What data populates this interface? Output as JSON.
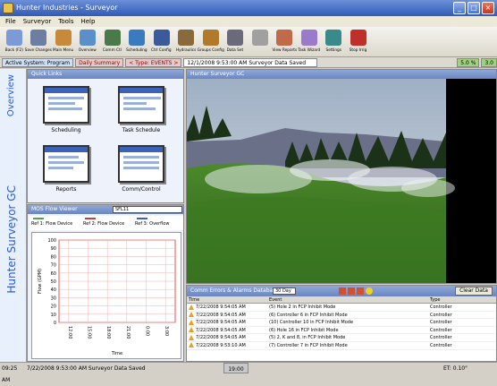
{
  "window": {
    "title": "Hunter Industries - Surveyor"
  },
  "menu": [
    "File",
    "Surveyor",
    "Tools",
    "Help"
  ],
  "toolbar": [
    {
      "label": "Back (F2)",
      "icon": "back-arrow-icon",
      "color": "#7a9ad8"
    },
    {
      "label": "Save Changes",
      "icon": "save-icon",
      "color": "#6d7fa0"
    },
    {
      "label": "Main Menu",
      "icon": "home-icon",
      "color": "#c88a3a"
    },
    {
      "label": "Overview",
      "icon": "map-icon",
      "color": "#5b8fc9"
    },
    {
      "label": "Comm Ctl",
      "icon": "antenna-icon",
      "color": "#4a7a4a"
    },
    {
      "label": "Scheduling",
      "icon": "magnifier-icon",
      "color": "#3a7bbf"
    },
    {
      "label": "Ctrl Config",
      "icon": "monitor-icon",
      "color": "#3a5a9a"
    },
    {
      "label": "Hydraulics",
      "icon": "valve-icon",
      "color": "#8a6a3a"
    },
    {
      "label": "Groups Config",
      "icon": "building-icon",
      "color": "#b07a2a"
    },
    {
      "label": "Data Set",
      "icon": "faucet-icon",
      "color": "#6a6a7a"
    },
    {
      "label": "",
      "icon": "wand-icon",
      "color": "#a0a0a0"
    },
    {
      "label": "View Reports",
      "icon": "report-icon",
      "color": "#c06a4a"
    },
    {
      "label": "Task Wizard",
      "icon": "wizard-icon",
      "color": "#9a7acb"
    },
    {
      "label": "Settings",
      "icon": "gear-icon",
      "color": "#3a8a8a"
    },
    {
      "label": "Stop Irrig",
      "icon": "stop-icon",
      "color": "#c0302a"
    }
  ],
  "statusline": {
    "system": "Active System: Program",
    "summary": "Daily Summary",
    "type": "< Type: EVENTS >",
    "event": "12/1/2008 9:53:00 AM Surveyor Data Saved",
    "left_val": "5.0 %",
    "right_val": "3.0"
  },
  "sidebar": {
    "overview": "Overview",
    "brand": "Hunter Surveyor GC"
  },
  "quick_links": {
    "title": "Quick Links",
    "items": [
      "Scheduling",
      "Task Schedule",
      "Reports",
      "Comm/Control"
    ]
  },
  "viewer": {
    "title": "MOS Flow Viewer",
    "select": "SFL11",
    "legend": [
      "Ref 1: Flow Device",
      "Ref 2: Flow Device",
      "Ref 3: Overflow"
    ],
    "legend_colors": [
      "#5aa04a",
      "#c04040",
      "#3a60c0"
    ]
  },
  "camera": {
    "title": "Hunter Surveyor GC"
  },
  "alarms": {
    "title": "Comm Errors & Alarms Database",
    "columns": [
      "Time",
      "Event",
      "Type"
    ],
    "filter": "30 Day",
    "clear": "Clear Data",
    "rows": [
      {
        "time": "7/22/2008 9:54:05 AM",
        "event": "(5) Hole 2 in FCP Inhibit Mode",
        "type": "Controller"
      },
      {
        "time": "7/22/2008 9:54:05 AM",
        "event": "(6) Controller 6 in FCP Inhibit Mode",
        "type": "Controller"
      },
      {
        "time": "7/22/2008 9:54:05 AM",
        "event": "(10) Controller 10 in FCP Inhibit Mode",
        "type": "Controller"
      },
      {
        "time": "7/22/2008 9:54:05 AM",
        "event": "(6) Hole 16 in FCP Inhibit Mode",
        "type": "Controller"
      },
      {
        "time": "7/22/2008 9:54:05 AM",
        "event": "(5) 2, K and 8, in FCP Inhibit Mode",
        "type": "Controller"
      },
      {
        "time": "7/22/2008 9:53:10 AM",
        "event": "(7) Controller 7 in FCP Inhibit Mode",
        "type": "Controller"
      }
    ]
  },
  "statusbar": {
    "left": "09:25 AM",
    "event": "7/22/2008 9:53:00 AM Surveyor Data Saved",
    "mid": "19:00",
    "right": "ET: 0.10\""
  },
  "chart_data": {
    "type": "line",
    "ylabel": "Flow (GPM)",
    "xlabel": "Time",
    "y_ticks": [
      "100",
      "90",
      "80",
      "70",
      "60",
      "50",
      "40",
      "30",
      "20",
      "10",
      "0"
    ],
    "x_ticks": [
      "12:00",
      "15:00",
      "18:00",
      "21:00",
      "0:00",
      "3:00"
    ],
    "ylim": [
      0,
      100
    ],
    "series": []
  }
}
